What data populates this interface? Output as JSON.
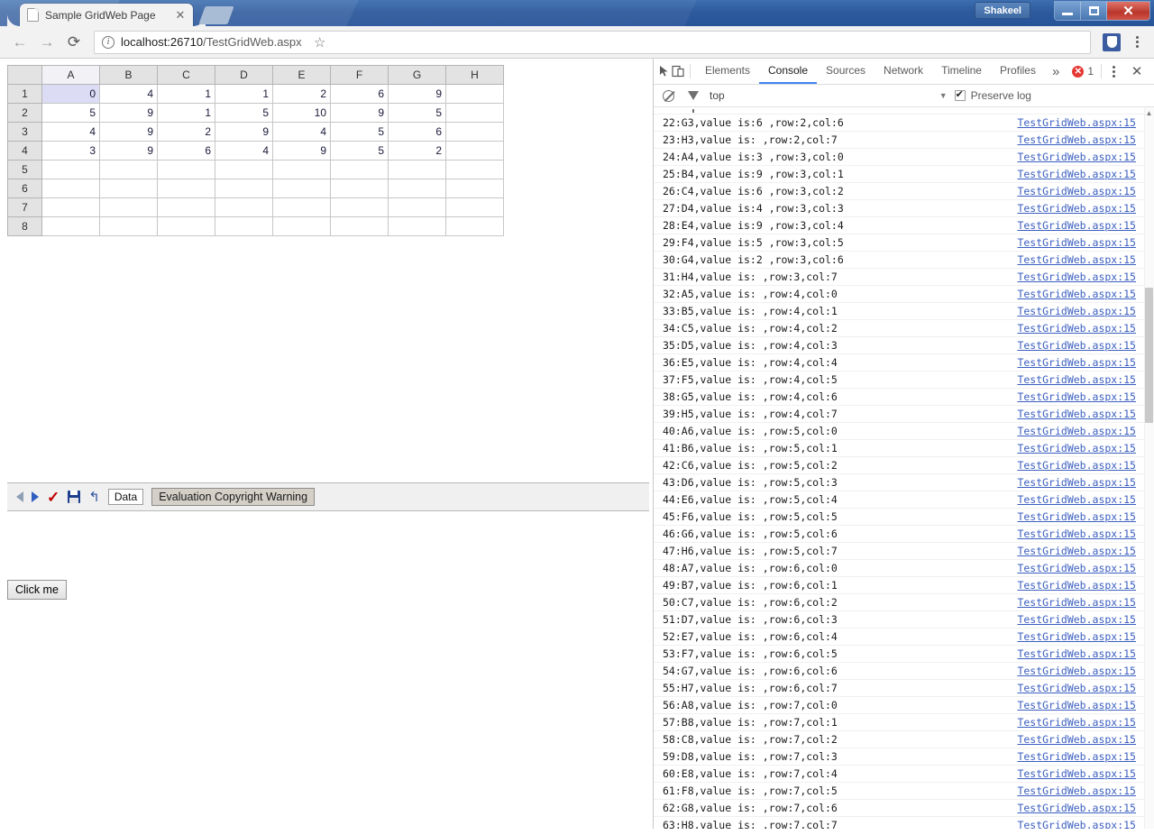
{
  "window": {
    "profile_label": "Shakeel",
    "minimize_icon": "minimize-icon",
    "maximize_icon": "maximize-icon",
    "close_label": "✕"
  },
  "browser": {
    "tab": {
      "title": "Sample GridWeb Page",
      "close_label": "✕",
      "favicon": "page-icon"
    },
    "newtab_label": "",
    "nav": {
      "back": "←",
      "forward": "→",
      "reload": "⟳"
    },
    "omnibox": {
      "info_icon": "ⓘ",
      "url_host": "localhost:26710",
      "url_path": "/TestGridWeb.aspx",
      "full_url": "localhost:26710/TestGridWeb.aspx"
    },
    "star_icon": "☆",
    "extension_icon": "shield-extension-icon",
    "menu_icon": "kebab-menu-icon"
  },
  "spreadsheet": {
    "columns": [
      "A",
      "B",
      "C",
      "D",
      "E",
      "F",
      "G",
      "H"
    ],
    "rows": [
      "1",
      "2",
      "3",
      "4",
      "5",
      "6",
      "7",
      "8"
    ],
    "selected_cell": "A1",
    "data": [
      [
        "0",
        "4",
        "1",
        "1",
        "2",
        "6",
        "9",
        ""
      ],
      [
        "5",
        "9",
        "1",
        "5",
        "10",
        "9",
        "5",
        ""
      ],
      [
        "4",
        "9",
        "2",
        "9",
        "4",
        "5",
        "6",
        ""
      ],
      [
        "3",
        "9",
        "6",
        "4",
        "9",
        "5",
        "2",
        ""
      ],
      [
        "",
        "",
        "",
        "",
        "",
        "",
        "",
        ""
      ],
      [
        "",
        "",
        "",
        "",
        "",
        "",
        "",
        ""
      ],
      [
        "",
        "",
        "",
        "",
        "",
        "",
        "",
        ""
      ],
      [
        "",
        "",
        "",
        "",
        "",
        "",
        "",
        ""
      ]
    ]
  },
  "gridweb_toolbar": {
    "prev_icon": "previous-arrow-icon",
    "next_icon": "next-arrow-icon",
    "submit_icon": "checkmark-icon",
    "save_icon": "save-floppy-icon",
    "undo_icon": "undo-icon",
    "undo_glyph": "↰",
    "check_glyph": "✓",
    "sheet_tab_label": "Data",
    "evaluation_label": "Evaluation Copyright Warning",
    "click_me_label": "Click me"
  },
  "devtools": {
    "inspect_icon": "inspect-element-icon",
    "device_icon": "device-toolbar-icon",
    "tabs": [
      {
        "label": "Elements",
        "active": false
      },
      {
        "label": "Console",
        "active": true
      },
      {
        "label": "Sources",
        "active": false
      },
      {
        "label": "Network",
        "active": false
      },
      {
        "label": "Timeline",
        "active": false
      },
      {
        "label": "Profiles",
        "active": false
      }
    ],
    "more_tabs_label": "»",
    "error_count": "1",
    "settings_icon": "kebab-menu-icon",
    "close_label": "✕",
    "filterbar": {
      "clear_icon": "clear-console-icon",
      "filter_icon": "filter-funnel-icon",
      "context": "top",
      "context_caret": "▼",
      "preserve_log_label": "Preserve log",
      "preserve_log_checked": true
    },
    "console": {
      "source_link": "TestGridWeb.aspx:15",
      "entries": [
        "22:G3,value is:6 ,row:2,col:6",
        "23:H3,value is: ,row:2,col:7",
        "24:A4,value is:3 ,row:3,col:0",
        "25:B4,value is:9 ,row:3,col:1",
        "26:C4,value is:6 ,row:3,col:2",
        "27:D4,value is:4 ,row:3,col:3",
        "28:E4,value is:9 ,row:3,col:4",
        "29:F4,value is:5 ,row:3,col:5",
        "30:G4,value is:2 ,row:3,col:6",
        "31:H4,value is: ,row:3,col:7",
        "32:A5,value is: ,row:4,col:0",
        "33:B5,value is: ,row:4,col:1",
        "34:C5,value is: ,row:4,col:2",
        "35:D5,value is: ,row:4,col:3",
        "36:E5,value is: ,row:4,col:4",
        "37:F5,value is: ,row:4,col:5",
        "38:G5,value is: ,row:4,col:6",
        "39:H5,value is: ,row:4,col:7",
        "40:A6,value is: ,row:5,col:0",
        "41:B6,value is: ,row:5,col:1",
        "42:C6,value is: ,row:5,col:2",
        "43:D6,value is: ,row:5,col:3",
        "44:E6,value is: ,row:5,col:4",
        "45:F6,value is: ,row:5,col:5",
        "46:G6,value is: ,row:5,col:6",
        "47:H6,value is: ,row:5,col:7",
        "48:A7,value is: ,row:6,col:0",
        "49:B7,value is: ,row:6,col:1",
        "50:C7,value is: ,row:6,col:2",
        "51:D7,value is: ,row:6,col:3",
        "52:E7,value is: ,row:6,col:4",
        "53:F7,value is: ,row:6,col:5",
        "54:G7,value is: ,row:6,col:6",
        "55:H7,value is: ,row:6,col:7",
        "56:A8,value is: ,row:7,col:0",
        "57:B8,value is: ,row:7,col:1",
        "58:C8,value is: ,row:7,col:2",
        "59:D8,value is: ,row:7,col:3",
        "60:E8,value is: ,row:7,col:4",
        "61:F8,value is: ,row:7,col:5",
        "62:G8,value is: ,row:7,col:6",
        "63:H8,value is: ,row:7,col:7"
      ]
    }
  }
}
